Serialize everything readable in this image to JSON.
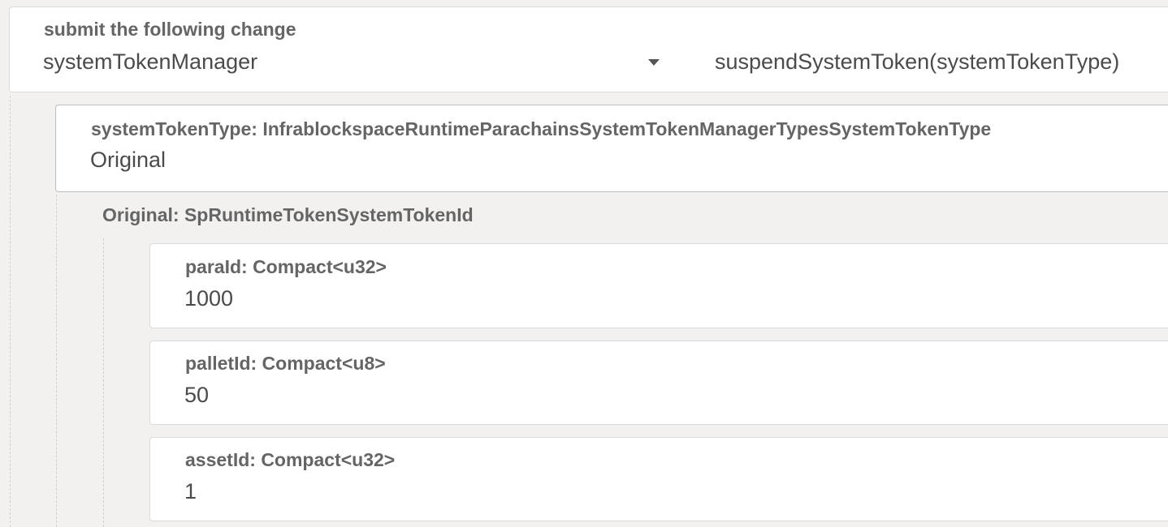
{
  "submit": {
    "label": "submit the following change",
    "module_value": "systemTokenManager",
    "method_value": "suspendSystemToken(systemTokenType)"
  },
  "system_token_type": {
    "label": "systemTokenType: InfrablockspaceRuntimeParachainsSystemTokenManagerTypesSystemTokenType",
    "value": "Original"
  },
  "original": {
    "label": "Original: SpRuntimeTokenSystemTokenId"
  },
  "fields": [
    {
      "label": "paraId: Compact<u32>",
      "value": "1000"
    },
    {
      "label": "palletId: Compact<u8>",
      "value": "50"
    },
    {
      "label": "assetId: Compact<u32>",
      "value": "1"
    }
  ]
}
